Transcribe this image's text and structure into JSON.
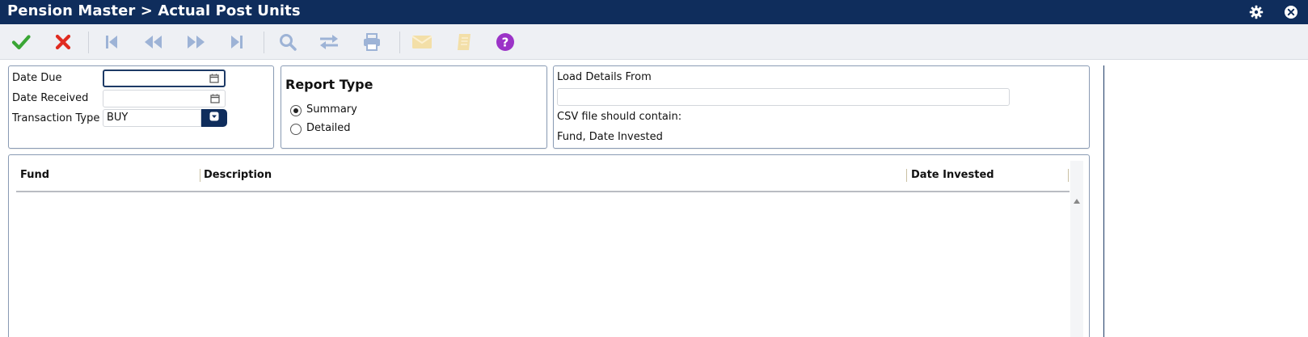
{
  "window": {
    "title": "Pension Master > Actual Post Units",
    "icons": [
      "gear-icon",
      "close-circle-icon"
    ]
  },
  "toolbar": {
    "buttons": [
      {
        "icon": "check-icon",
        "color": "#3aa635",
        "enabled": true
      },
      {
        "icon": "cross-icon",
        "color": "#e02b20",
        "enabled": true
      },
      {
        "icon": "first-record-icon",
        "color": "#9db3d6",
        "enabled": false
      },
      {
        "icon": "previous-record-icon",
        "color": "#9db3d6",
        "enabled": false
      },
      {
        "icon": "next-record-icon",
        "color": "#9db3d6",
        "enabled": false
      },
      {
        "icon": "last-record-icon",
        "color": "#9db3d6",
        "enabled": false
      },
      {
        "icon": "search-icon",
        "color": "#9db3d6",
        "enabled": false
      },
      {
        "icon": "transfer-icon",
        "color": "#9db3d6",
        "enabled": false
      },
      {
        "icon": "print-icon",
        "color": "#9db3d6",
        "enabled": false
      },
      {
        "icon": "mail-icon",
        "color": "#f3dfa8",
        "enabled": false
      },
      {
        "icon": "notebook-icon",
        "color": "#f3dfa8",
        "enabled": false
      },
      {
        "icon": "help-icon",
        "color": "#9b33c7",
        "enabled": true
      }
    ]
  },
  "filters": {
    "date_due_label": "Date Due",
    "date_due_value": "",
    "date_received_label": "Date Received",
    "date_received_value": "",
    "transaction_type_label": "Transaction Type",
    "transaction_type_value": "BUY"
  },
  "report_type": {
    "heading": "Report Type",
    "options": [
      {
        "label": "Summary",
        "selected": true
      },
      {
        "label": "Detailed",
        "selected": false
      }
    ]
  },
  "load_details": {
    "label": "Load Details From",
    "value": "",
    "csv_hint": "CSV file should contain:",
    "csv_columns": "Fund, Date Invested"
  },
  "grid": {
    "columns": [
      "Fund",
      "Description",
      "Date Invested"
    ],
    "rows": []
  },
  "colors": {
    "titlebar": "#0f2d5c",
    "toolbar_bg": "#eef0f4",
    "panel_border": "#8a9bb4"
  }
}
